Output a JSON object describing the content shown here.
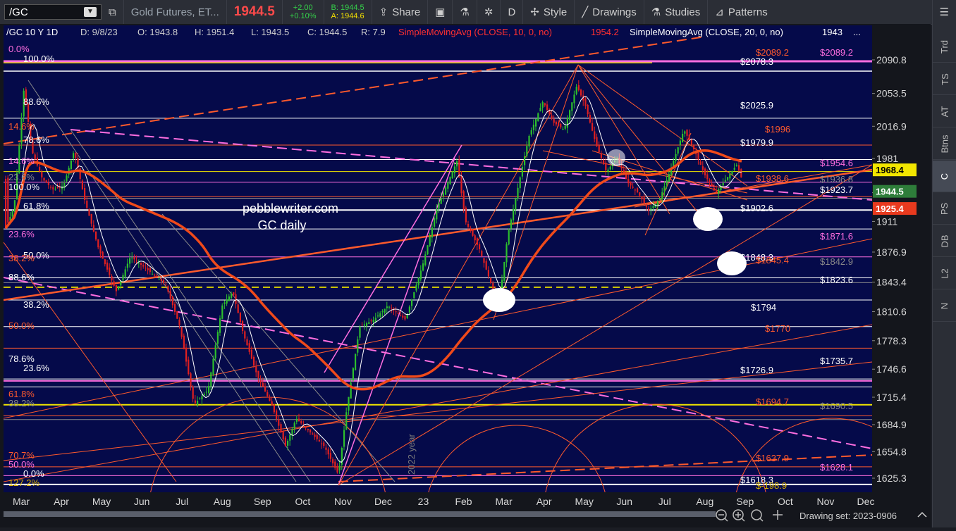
{
  "toolbar": {
    "symbol": "/GC",
    "name": "Gold Futures, ET...",
    "price": "1944.5",
    "change": "+2.00",
    "change_pct": "+0.10%",
    "bid": "B: 1944.5",
    "ask": "A: 1944.6",
    "share": "Share",
    "period_letter": "D",
    "style": "Style",
    "drawings": "Drawings",
    "studies": "Studies",
    "patterns": "Patterns"
  },
  "header": {
    "title": "/GC 10 Y 1D",
    "d": "D: 9/8/23",
    "o": "O: 1943.8",
    "h": "H: 1951.4",
    "l": "L: 1943.5",
    "c": "C: 1944.5",
    "r": "R: 7.9",
    "sma10": "SimpleMovingAvg (CLOSE, 10, 0, no)",
    "sma10_val": "1954.2",
    "sma20": "SimpleMovingAvg (CLOSE, 20, 0, no)",
    "sma20_val": "1943",
    "more": "..."
  },
  "watermark": {
    "site": "pebblewriter.com",
    "title": "GC daily",
    "vertical": "2022 year"
  },
  "price_axis": [
    "2090.8",
    "2053.5",
    "2016.9",
    "1981",
    "1943",
    "1911",
    "1876.9",
    "1843.4",
    "1810.6",
    "1778.3",
    "1746.6",
    "1715.4",
    "1684.9",
    "1654.8",
    "1625.3"
  ],
  "price_tags": [
    {
      "text": "1968.4",
      "bg": "#f2e600",
      "fg": "#000000"
    },
    {
      "text": "1944.5",
      "bg": "#2e7d3a",
      "fg": "#ffffff"
    },
    {
      "text": "1925.4",
      "bg": "#e83a1e",
      "fg": "#ffffff"
    }
  ],
  "time_axis": [
    "Mar",
    "Apr",
    "May",
    "Jun",
    "Jul",
    "Aug",
    "Sep",
    "Oct",
    "Nov",
    "Dec",
    "23",
    "Feb",
    "Mar",
    "Apr",
    "May",
    "Jun",
    "Jul",
    "Aug",
    "Sep",
    "Oct",
    "Nov",
    "Dec"
  ],
  "right_levels": [
    {
      "text": "$2089.2",
      "color": "#ff5a2c"
    },
    {
      "text": "$2089.2",
      "color": "#ff6ee0"
    },
    {
      "text": "$2078.3",
      "color": "#ffffff"
    },
    {
      "text": "$2025.9",
      "color": "#ffffff"
    },
    {
      "text": "$1996",
      "color": "#ff5a2c"
    },
    {
      "text": "$1979.9",
      "color": "#ffffff"
    },
    {
      "text": "$1954.6",
      "color": "#ff6ee0"
    },
    {
      "text": "$1938.6",
      "color": "#ff5a2c"
    },
    {
      "text": "$1936.8",
      "color": "#8a8a8a"
    },
    {
      "text": "$1923.7",
      "color": "#ffffff"
    },
    {
      "text": "$1902.6",
      "color": "#ffffff"
    },
    {
      "text": "$1871.6",
      "color": "#ff6ee0"
    },
    {
      "text": "$1848.3",
      "color": "#ffffff"
    },
    {
      "text": "$1845.4",
      "color": "#ff5a2c"
    },
    {
      "text": "$1842.9",
      "color": "#8a8a8a"
    },
    {
      "text": "$1823.6",
      "color": "#ffffff"
    },
    {
      "text": "$1794",
      "color": "#ffffff"
    },
    {
      "text": "$1770",
      "color": "#ff5a2c"
    },
    {
      "text": "$1735.7",
      "color": "#ffffff"
    },
    {
      "text": "$1726.9",
      "color": "#ffffff"
    },
    {
      "text": "$1694.7",
      "color": "#ff5a2c"
    },
    {
      "text": "$1690.5",
      "color": "#8a8a8a"
    },
    {
      "text": "$1637.9",
      "color": "#ff5a2c"
    },
    {
      "text": "$1628.1",
      "color": "#ff6ee0"
    },
    {
      "text": "$1618.3",
      "color": "#ffffff"
    },
    {
      "text": "$-198.9",
      "color": "#d8b000"
    }
  ],
  "left_fibs": [
    {
      "text": "0.0%",
      "color": "#ff6ee0"
    },
    {
      "text": "100.0%",
      "color": "#ffffff"
    },
    {
      "text": "88.6%",
      "color": "#ffffff"
    },
    {
      "text": "14.6%",
      "color": "#ff5a2c"
    },
    {
      "text": "78.6%",
      "color": "#ffffff"
    },
    {
      "text": "14.6%",
      "color": "#ff6ee0"
    },
    {
      "text": "23.6%",
      "color": "#8a8a8a"
    },
    {
      "text": "100.0%",
      "color": "#ffffff"
    },
    {
      "text": "61.8%",
      "color": "#ffffff"
    },
    {
      "text": "23.6%",
      "color": "#ff6ee0"
    },
    {
      "text": "50.0%",
      "color": "#ffffff"
    },
    {
      "text": "38.2%",
      "color": "#ff5a2c"
    },
    {
      "text": "88.6%",
      "color": "#ffffff"
    },
    {
      "text": "38.2%",
      "color": "#ffffff"
    },
    {
      "text": "50.0%",
      "color": "#ff5a2c"
    },
    {
      "text": "78.6%",
      "color": "#ffffff"
    },
    {
      "text": "23.6%",
      "color": "#ffffff"
    },
    {
      "text": "61.8%",
      "color": "#ff5a2c"
    },
    {
      "text": "38.2%",
      "color": "#8a8a8a"
    },
    {
      "text": "70.7%",
      "color": "#ff5a2c"
    },
    {
      "text": "50.0%",
      "color": "#ff6ee0"
    },
    {
      "text": "0.0%",
      "color": "#ffffff"
    },
    {
      "text": "127.2%",
      "color": "#d8b000"
    }
  ],
  "sidebar": [
    "Trd",
    "TS",
    "AT",
    "Btns",
    "C",
    "PS",
    "DB",
    "L2",
    "N"
  ],
  "footer": {
    "drawing_set": "Drawing set: 2023-0906"
  },
  "colors": {
    "chart_bg": "#050a4a",
    "candle_up": "#2dbf2d",
    "candle_down": "#e02020",
    "sma_yellow": "#f5e000",
    "sma_blue": "#7a78f0",
    "sma_red": "#f04a1a",
    "fib_pink": "#ff6ee0"
  }
}
